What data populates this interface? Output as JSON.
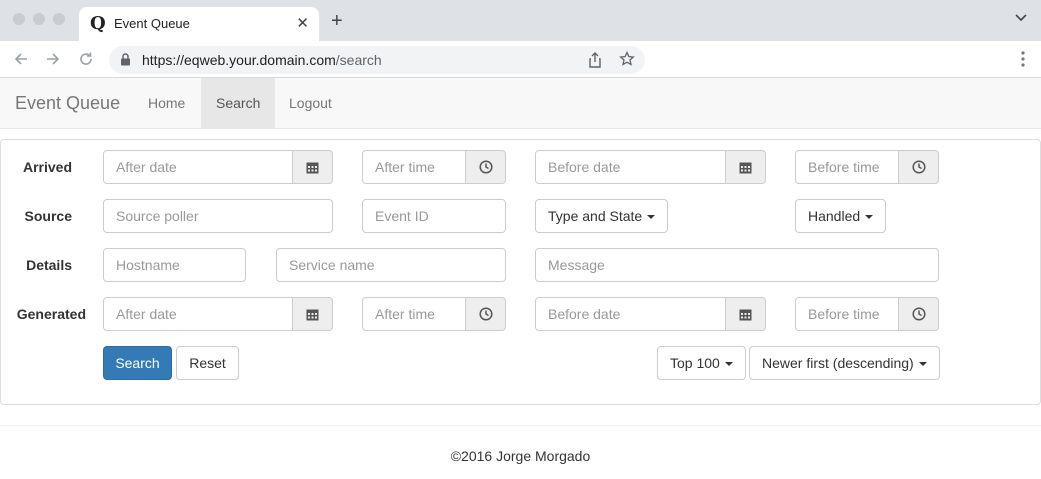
{
  "browser": {
    "tab_title": "Event Queue",
    "favicon": "Q",
    "url_host": "https://eqweb.your.domain.com",
    "url_path": "/search"
  },
  "navbar": {
    "brand": "Event Queue",
    "links": [
      "Home",
      "Search",
      "Logout"
    ],
    "active": "Search"
  },
  "form": {
    "arrived": {
      "label": "Arrived",
      "after_date": "After date",
      "after_time": "After time",
      "before_date": "Before date",
      "before_time": "Before time"
    },
    "source": {
      "label": "Source",
      "poller": "Source poller",
      "event_id": "Event ID",
      "type_state": "Type and State",
      "handled": "Handled"
    },
    "details": {
      "label": "Details",
      "hostname": "Hostname",
      "service": "Service name",
      "message": "Message"
    },
    "generated": {
      "label": "Generated",
      "after_date": "After date",
      "after_time": "After time",
      "before_date": "Before date",
      "before_time": "Before time"
    },
    "actions": {
      "search": "Search",
      "reset": "Reset",
      "limit": "Top 100",
      "order": "Newer first (descending)"
    }
  },
  "footer": "©2016 Jorge Morgado",
  "colors": {
    "primary": "#337ab7",
    "navbar_bg": "#f8f8f8",
    "active_nav_bg": "#e7e7e7"
  },
  "icons": [
    "calendar-icon",
    "clock-icon",
    "caret-down-icon",
    "lock-icon",
    "star-icon",
    "share-icon"
  ]
}
